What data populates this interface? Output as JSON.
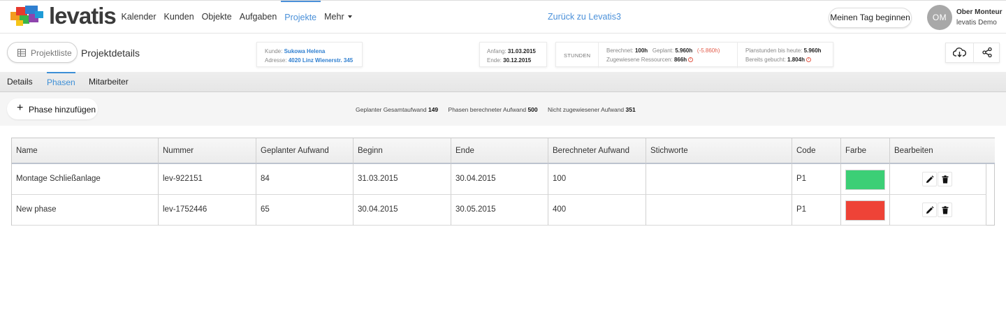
{
  "brand": {
    "name": "levatis",
    "colors": [
      "#e63a2e",
      "#f39c1f",
      "#2f7fd0",
      "#38b549",
      "#8e44ad"
    ]
  },
  "topnav": {
    "items": [
      {
        "label": "Kalender",
        "active": false
      },
      {
        "label": "Kunden",
        "active": false
      },
      {
        "label": "Objekte",
        "active": false
      },
      {
        "label": "Aufgaben",
        "active": false
      },
      {
        "label": "Projekte",
        "active": true
      },
      {
        "label": "Mehr",
        "active": false,
        "dropdown": true
      }
    ],
    "back_link": "Zurück zu Levatis3",
    "day_button": "Meinen Tag beginnen",
    "user": {
      "initials": "OM",
      "name": "Ober Monteur",
      "org": "levatis Demo"
    }
  },
  "project": {
    "list_button": "Projektliste",
    "title": "Projektdetails",
    "customer_label": "Kunde:",
    "customer": "Sukowa Helena",
    "address_label": "Adresse:",
    "address": "4020 Linz Wienerstr. 345",
    "start_label": "Anfang:",
    "start": "31.03.2015",
    "end_label": "Ende:",
    "end": "30.12.2015",
    "hours_label": "STUNDEN",
    "computed_label": "Berechnet:",
    "computed": "100h",
    "planned_label": "Geplant:",
    "planned": "5.960h",
    "planned_diff": "(-5.860h)",
    "assigned_label": "Zugewiesene Ressourcen:",
    "assigned": "866h",
    "plan_today_label": "Planstunden bis heute:",
    "plan_today": "5.960h",
    "booked_label": "Bereits gebucht:",
    "booked": "1.804h",
    "icons": [
      "cloud-download-icon",
      "share-icon"
    ]
  },
  "tabs": [
    {
      "label": "Details",
      "active": false
    },
    {
      "label": "Phasen",
      "active": true
    },
    {
      "label": "Mitarbeiter",
      "active": false
    }
  ],
  "actions": {
    "add_phase": "Phase hinzufügen",
    "summary": [
      {
        "label": "Geplanter Gesamtaufwand",
        "value": "149"
      },
      {
        "label": "Phasen berechneter Aufwand",
        "value": "500"
      },
      {
        "label": "Nicht zugewiesener Aufwand",
        "value": "351"
      }
    ]
  },
  "table": {
    "columns": [
      "Name",
      "Nummer",
      "Geplanter Aufwand",
      "Beginn",
      "Ende",
      "Berechneter Aufwand",
      "Stichworte",
      "Code",
      "Farbe",
      "Bearbeiten"
    ],
    "rows": [
      {
        "name": "Montage Schließanlage",
        "number": "lev-922151",
        "planned": "84",
        "start": "31.03.2015",
        "end": "30.04.2015",
        "computed": "100",
        "keywords": "",
        "code": "P1",
        "color": "#3ccf76"
      },
      {
        "name": "New phase",
        "number": "lev-1752446",
        "planned": "65",
        "start": "30.04.2015",
        "end": "30.05.2015",
        "computed": "400",
        "keywords": "",
        "code": "P1",
        "color": "#ee4337"
      }
    ]
  }
}
